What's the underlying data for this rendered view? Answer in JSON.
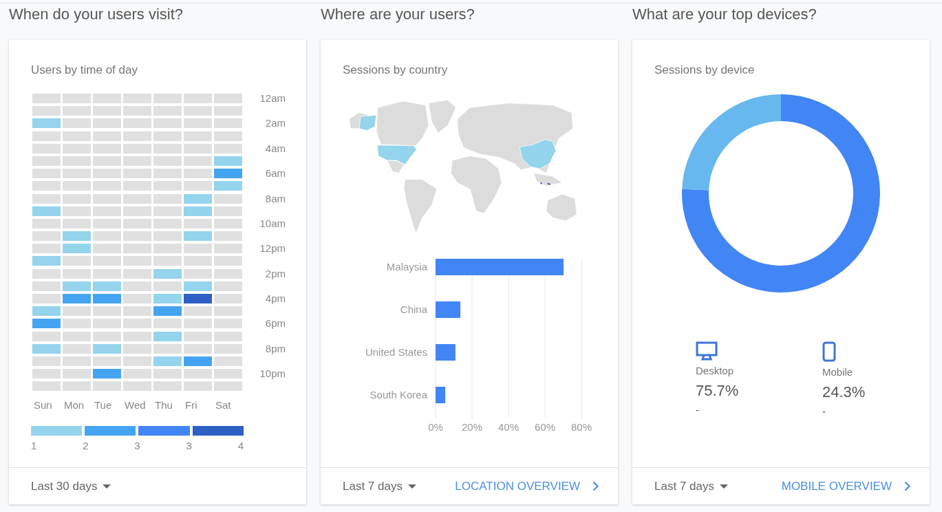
{
  "sections": [
    {
      "heading": "When do your users visit?",
      "card": {
        "kind": "heatmap",
        "title": "Users by time of day",
        "hours": [
          {
            "label": "12am",
            "cells": [
              {
                "color": "#e0e0e0"
              },
              {
                "color": "#e0e0e0"
              },
              {
                "color": "#e0e0e0"
              },
              {
                "color": "#e0e0e0"
              },
              {
                "color": "#e0e0e0"
              },
              {
                "color": "#e0e0e0"
              },
              {
                "color": "#e0e0e0"
              }
            ]
          },
          {
            "cells": [
              {
                "color": "#e0e0e0"
              },
              {
                "color": "#e0e0e0"
              },
              {
                "color": "#e0e0e0"
              },
              {
                "color": "#e0e0e0"
              },
              {
                "color": "#e0e0e0"
              },
              {
                "color": "#e0e0e0"
              },
              {
                "color": "#e0e0e0"
              }
            ]
          },
          {
            "label": "2am",
            "cells": [
              {
                "color": "#94d4ec"
              },
              {
                "color": "#e0e0e0"
              },
              {
                "color": "#e0e0e0"
              },
              {
                "color": "#e0e0e0"
              },
              {
                "color": "#e0e0e0"
              },
              {
                "color": "#e0e0e0"
              },
              {
                "color": "#e0e0e0"
              }
            ]
          },
          {
            "cells": [
              {
                "color": "#e0e0e0"
              },
              {
                "color": "#e0e0e0"
              },
              {
                "color": "#e0e0e0"
              },
              {
                "color": "#e0e0e0"
              },
              {
                "color": "#e0e0e0"
              },
              {
                "color": "#e0e0e0"
              },
              {
                "color": "#e0e0e0"
              }
            ]
          },
          {
            "label": "4am",
            "cells": [
              {
                "color": "#e0e0e0"
              },
              {
                "color": "#e0e0e0"
              },
              {
                "color": "#e0e0e0"
              },
              {
                "color": "#e0e0e0"
              },
              {
                "color": "#e0e0e0"
              },
              {
                "color": "#e0e0e0"
              },
              {
                "color": "#e0e0e0"
              }
            ]
          },
          {
            "cells": [
              {
                "color": "#e0e0e0"
              },
              {
                "color": "#e0e0e0"
              },
              {
                "color": "#e0e0e0"
              },
              {
                "color": "#e0e0e0"
              },
              {
                "color": "#e0e0e0"
              },
              {
                "color": "#e0e0e0"
              },
              {
                "color": "#94d4ec"
              }
            ]
          },
          {
            "label": "6am",
            "cells": [
              {
                "color": "#e0e0e0"
              },
              {
                "color": "#e0e0e0"
              },
              {
                "color": "#e0e0e0"
              },
              {
                "color": "#e0e0e0"
              },
              {
                "color": "#e0e0e0"
              },
              {
                "color": "#e0e0e0"
              },
              {
                "color": "#45a4f2"
              }
            ]
          },
          {
            "cells": [
              {
                "color": "#e0e0e0"
              },
              {
                "color": "#e0e0e0"
              },
              {
                "color": "#e0e0e0"
              },
              {
                "color": "#e0e0e0"
              },
              {
                "color": "#e0e0e0"
              },
              {
                "color": "#e0e0e0"
              },
              {
                "color": "#94d4ec"
              }
            ]
          },
          {
            "label": "8am",
            "cells": [
              {
                "color": "#e0e0e0"
              },
              {
                "color": "#e0e0e0"
              },
              {
                "color": "#e0e0e0"
              },
              {
                "color": "#e0e0e0"
              },
              {
                "color": "#e0e0e0"
              },
              {
                "color": "#94d4ec"
              },
              {
                "color": "#e0e0e0"
              }
            ]
          },
          {
            "cells": [
              {
                "color": "#94d4ec"
              },
              {
                "color": "#e0e0e0"
              },
              {
                "color": "#e0e0e0"
              },
              {
                "color": "#e0e0e0"
              },
              {
                "color": "#e0e0e0"
              },
              {
                "color": "#94d4ec"
              },
              {
                "color": "#e0e0e0"
              }
            ]
          },
          {
            "label": "10am",
            "cells": [
              {
                "color": "#e0e0e0"
              },
              {
                "color": "#e0e0e0"
              },
              {
                "color": "#e0e0e0"
              },
              {
                "color": "#e0e0e0"
              },
              {
                "color": "#e0e0e0"
              },
              {
                "color": "#e0e0e0"
              },
              {
                "color": "#e0e0e0"
              }
            ]
          },
          {
            "cells": [
              {
                "color": "#e0e0e0"
              },
              {
                "color": "#94d4ec"
              },
              {
                "color": "#e0e0e0"
              },
              {
                "color": "#e0e0e0"
              },
              {
                "color": "#e0e0e0"
              },
              {
                "color": "#94d4ec"
              },
              {
                "color": "#e0e0e0"
              }
            ]
          },
          {
            "label": "12pm",
            "cells": [
              {
                "color": "#e0e0e0"
              },
              {
                "color": "#94d4ec"
              },
              {
                "color": "#e0e0e0"
              },
              {
                "color": "#e0e0e0"
              },
              {
                "color": "#e0e0e0"
              },
              {
                "color": "#e0e0e0"
              },
              {
                "color": "#e0e0e0"
              }
            ]
          },
          {
            "cells": [
              {
                "color": "#94d4ec"
              },
              {
                "color": "#e0e0e0"
              },
              {
                "color": "#e0e0e0"
              },
              {
                "color": "#e0e0e0"
              },
              {
                "color": "#e0e0e0"
              },
              {
                "color": "#e0e0e0"
              },
              {
                "color": "#e0e0e0"
              }
            ]
          },
          {
            "label": "2pm",
            "cells": [
              {
                "color": "#e0e0e0"
              },
              {
                "color": "#e0e0e0"
              },
              {
                "color": "#e0e0e0"
              },
              {
                "color": "#e0e0e0"
              },
              {
                "color": "#94d4ec"
              },
              {
                "color": "#e0e0e0"
              },
              {
                "color": "#e0e0e0"
              }
            ]
          },
          {
            "cells": [
              {
                "color": "#e0e0e0"
              },
              {
                "color": "#94d4ec"
              },
              {
                "color": "#94d4ec"
              },
              {
                "color": "#e0e0e0"
              },
              {
                "color": "#e0e0e0"
              },
              {
                "color": "#94d4ec"
              },
              {
                "color": "#e0e0e0"
              }
            ]
          },
          {
            "label": "4pm",
            "cells": [
              {
                "color": "#e0e0e0"
              },
              {
                "color": "#45a4f2"
              },
              {
                "color": "#45a4f2"
              },
              {
                "color": "#e0e0e0"
              },
              {
                "color": "#94d4ec"
              },
              {
                "color": "#2f5ec4"
              },
              {
                "color": "#e0e0e0"
              }
            ]
          },
          {
            "cells": [
              {
                "color": "#94d4ec"
              },
              {
                "color": "#e0e0e0"
              },
              {
                "color": "#e0e0e0"
              },
              {
                "color": "#e0e0e0"
              },
              {
                "color": "#45a4f2"
              },
              {
                "color": "#e0e0e0"
              },
              {
                "color": "#e0e0e0"
              }
            ]
          },
          {
            "label": "6pm",
            "cells": [
              {
                "color": "#45a4f2"
              },
              {
                "color": "#e0e0e0"
              },
              {
                "color": "#e0e0e0"
              },
              {
                "color": "#e0e0e0"
              },
              {
                "color": "#e0e0e0"
              },
              {
                "color": "#e0e0e0"
              },
              {
                "color": "#e0e0e0"
              }
            ]
          },
          {
            "cells": [
              {
                "color": "#e0e0e0"
              },
              {
                "color": "#e0e0e0"
              },
              {
                "color": "#e0e0e0"
              },
              {
                "color": "#e0e0e0"
              },
              {
                "color": "#94d4ec"
              },
              {
                "color": "#e0e0e0"
              },
              {
                "color": "#e0e0e0"
              }
            ]
          },
          {
            "label": "8pm",
            "cells": [
              {
                "color": "#94d4ec"
              },
              {
                "color": "#e0e0e0"
              },
              {
                "color": "#94d4ec"
              },
              {
                "color": "#e0e0e0"
              },
              {
                "color": "#e0e0e0"
              },
              {
                "color": "#e0e0e0"
              },
              {
                "color": "#e0e0e0"
              }
            ]
          },
          {
            "cells": [
              {
                "color": "#e0e0e0"
              },
              {
                "color": "#e0e0e0"
              },
              {
                "color": "#e0e0e0"
              },
              {
                "color": "#e0e0e0"
              },
              {
                "color": "#94d4ec"
              },
              {
                "color": "#45a4f2"
              },
              {
                "color": "#e0e0e0"
              }
            ]
          },
          {
            "label": "10pm",
            "cells": [
              {
                "color": "#e0e0e0"
              },
              {
                "color": "#e0e0e0"
              },
              {
                "color": "#45a4f2"
              },
              {
                "color": "#e0e0e0"
              },
              {
                "color": "#e0e0e0"
              },
              {
                "color": "#e0e0e0"
              },
              {
                "color": "#e0e0e0"
              }
            ]
          },
          {
            "cells": [
              {
                "color": "#e0e0e0"
              },
              {
                "color": "#e0e0e0"
              },
              {
                "color": "#e0e0e0"
              },
              {
                "color": "#e0e0e0"
              },
              {
                "color": "#e0e0e0"
              },
              {
                "color": "#e0e0e0"
              },
              {
                "color": "#e0e0e0"
              }
            ]
          }
        ],
        "days": [
          "Sun",
          "Mon",
          "Tue",
          "Wed",
          "Thu",
          "Fri",
          "Sat"
        ],
        "legend": {
          "swatches": [
            {
              "color": "#94d4ec"
            },
            {
              "color": "#45a4f2"
            },
            {
              "color": "#4285f4"
            },
            {
              "color": "#2f5ec4"
            }
          ],
          "labels": [
            "1",
            "2",
            "3",
            "3",
            "4"
          ]
        },
        "footer": {
          "range": "Last 30 days"
        }
      }
    },
    {
      "heading": "Where are your users?",
      "card": {
        "kind": "geo",
        "title": "Sessions by country",
        "chart_data": {
          "type": "bar",
          "orientation": "horizontal",
          "categories": [
            "Malaysia",
            "China",
            "United States",
            "South Korea"
          ],
          "series": [
            {
              "color": "#4285f4",
              "values": [
                70.2,
                13.6,
                10.9,
                5.3
              ]
            }
          ],
          "xlim": [
            0,
            80
          ],
          "grid": true,
          "xticks": [
            {
              "value": 0,
              "label": "0%"
            },
            {
              "value": 20,
              "label": "20%"
            },
            {
              "value": 40,
              "label": "40%"
            },
            {
              "value": 60,
              "label": "60%"
            },
            {
              "value": 80,
              "label": "80%"
            }
          ]
        },
        "footer": {
          "range": "Last 7 days",
          "link": "LOCATION OVERVIEW"
        }
      }
    },
    {
      "heading": "What are your top devices?",
      "card": {
        "kind": "devices",
        "title": "Sessions by device",
        "chart_data": {
          "type": "donut",
          "categories": [
            "Desktop",
            "Mobile"
          ],
          "series": [
            {
              "values": [
                75.7,
                24.3
              ]
            }
          ]
        },
        "devices": [
          {
            "kind": "desktop",
            "share": "75.7%",
            "change": "-"
          },
          {
            "kind": "mobile",
            "share": "24.3%",
            "change": "-"
          }
        ],
        "footer": {
          "range": "Last 7 days",
          "link": "MOBILE OVERVIEW"
        }
      }
    }
  ]
}
